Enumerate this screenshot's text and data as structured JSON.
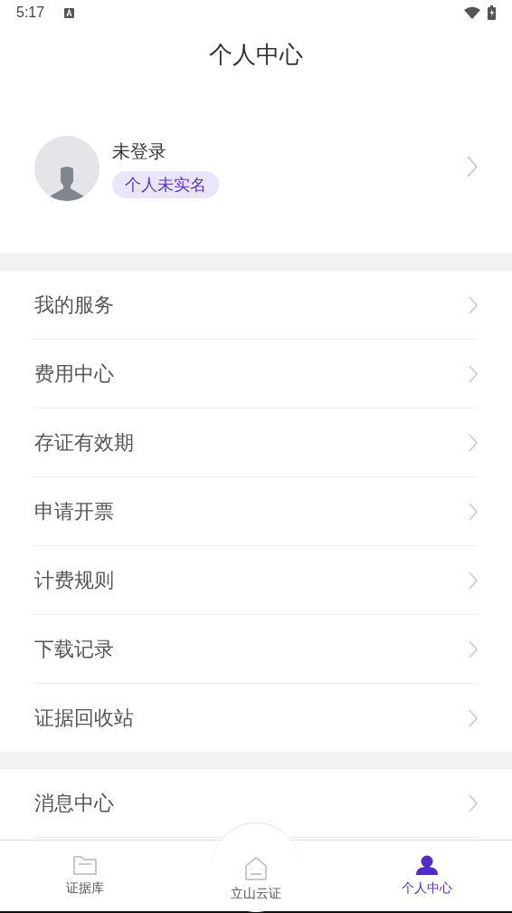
{
  "status_bar": {
    "time": "5:17"
  },
  "header": {
    "title": "个人中心"
  },
  "profile": {
    "name": "未登录",
    "badge": "个人未实名"
  },
  "menu_groups": [
    {
      "items": [
        {
          "label": "我的服务"
        },
        {
          "label": "费用中心"
        },
        {
          "label": "存证有效期"
        },
        {
          "label": "申请开票"
        },
        {
          "label": "计费规则"
        },
        {
          "label": "下载记录"
        },
        {
          "label": "证据回收站"
        }
      ]
    },
    {
      "items": [
        {
          "label": "消息中心"
        }
      ]
    }
  ],
  "tab_bar": [
    {
      "label": "证据库",
      "kind": "folder",
      "selected": false
    },
    {
      "label": "立山云证",
      "kind": "home",
      "selected": false
    },
    {
      "label": "个人中心",
      "kind": "person",
      "selected": true
    }
  ]
}
